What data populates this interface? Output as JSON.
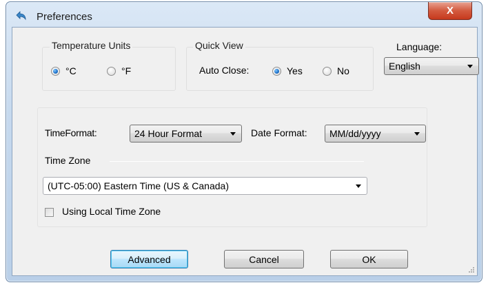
{
  "window": {
    "title": "Preferences",
    "close_glyph": "X"
  },
  "temperature": {
    "legend": "Temperature Units",
    "options": [
      {
        "label": "°C",
        "selected": true
      },
      {
        "label": "°F",
        "selected": false
      }
    ]
  },
  "quick_view": {
    "legend": "Quick View",
    "auto_close_label": "Auto Close:",
    "options": [
      {
        "label": "Yes",
        "selected": true
      },
      {
        "label": "No",
        "selected": false
      }
    ]
  },
  "language": {
    "label": "Language:",
    "value": "English"
  },
  "time": {
    "time_format_label": "TimeFormat:",
    "time_format_value": "24 Hour Format",
    "date_format_label": "Date Format:",
    "date_format_value": "MM/dd/yyyy",
    "time_zone_label": "Time Zone",
    "time_zone_value": "(UTC-05:00) Eastern Time (US & Canada)",
    "local_tz_label": "Using Local Time Zone",
    "local_tz_checked": false
  },
  "buttons": {
    "advanced": "Advanced",
    "cancel": "Cancel",
    "ok": "OK"
  },
  "colors": {
    "titlebar": "#c6d9ee",
    "close_button": "#c6391d",
    "dialog_face": "#f0f0f0",
    "radio_selected": "#1b6ec6",
    "default_button_border": "#3c7fb1"
  },
  "icons": {
    "app": "back-arrow-icon",
    "close": "close-icon",
    "dropdown": "chevron-down-icon",
    "resize": "resize-grip-icon"
  }
}
